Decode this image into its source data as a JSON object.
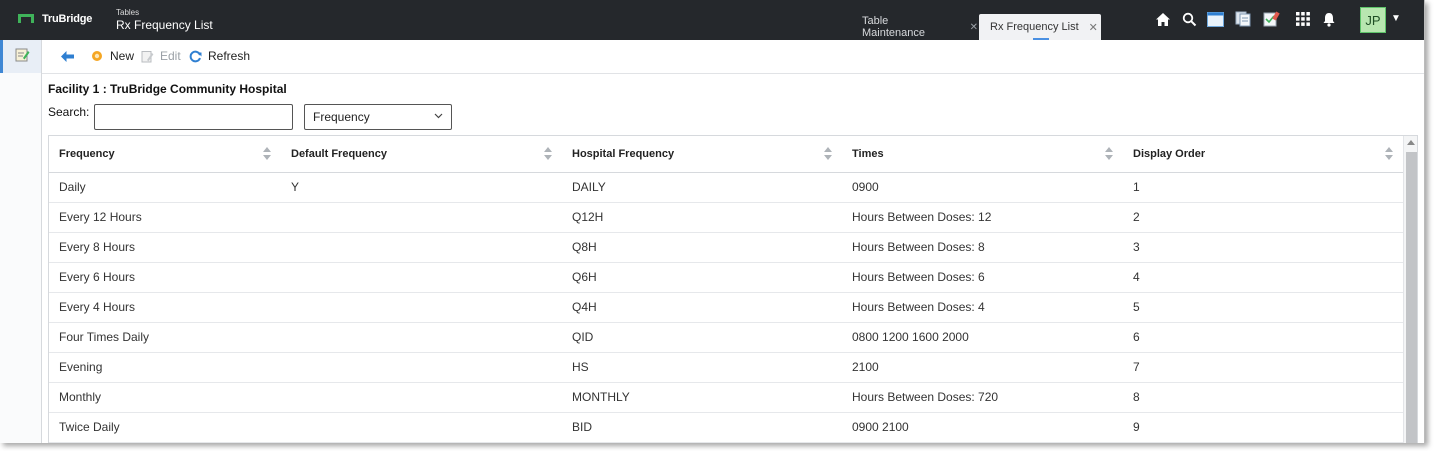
{
  "app": {
    "logo_text": "TruBridge",
    "breadcrumb_small": "Tables",
    "breadcrumb_title": "Rx Frequency List"
  },
  "tabs": [
    {
      "label": "Table Maintenance",
      "active": false
    },
    {
      "label": "Rx Frequency List",
      "active": true
    }
  ],
  "header_icons": [
    "home-icon",
    "search-icon",
    "window-icon",
    "documents-icon",
    "checklist-icon",
    "apps-grid-icon",
    "bell-icon"
  ],
  "user": {
    "initials": "JP"
  },
  "toolbar": {
    "new_label": "New",
    "edit_label": "Edit",
    "refresh_label": "Refresh"
  },
  "facility_title": "Facility 1 : TruBridge Community Hospital",
  "search": {
    "label": "Search:",
    "value": "",
    "placeholder": ""
  },
  "filter_select": {
    "value": "Frequency"
  },
  "table": {
    "columns": [
      "Frequency",
      "Default Frequency",
      "Hospital Frequency",
      "Times",
      "Display Order"
    ],
    "rows": [
      [
        "Daily",
        "Y",
        "DAILY",
        "0900",
        "1"
      ],
      [
        "Every 12 Hours",
        "",
        "Q12H",
        "Hours Between Doses: 12",
        "2"
      ],
      [
        "Every 8 Hours",
        "",
        "Q8H",
        "Hours Between Doses: 8",
        "3"
      ],
      [
        "Every 6 Hours",
        "",
        "Q6H",
        "Hours Between Doses: 6",
        "4"
      ],
      [
        "Every 4 Hours",
        "",
        "Q4H",
        "Hours Between Doses: 4",
        "5"
      ],
      [
        "Four Times Daily",
        "",
        "QID",
        "0800 1200 1600 2000",
        "6"
      ],
      [
        "Evening",
        "",
        "HS",
        "2100",
        "7"
      ],
      [
        "Monthly",
        "",
        "MONTHLY",
        "Hours Between Doses: 720",
        "8"
      ],
      [
        "Twice Daily",
        "",
        "BID",
        "0900 2100",
        "9"
      ]
    ]
  },
  "colors": {
    "topbar": "#25282c",
    "accent": "#3f87d4",
    "brand_green": "#3fb35a",
    "avatar_bg": "#b8e6b0"
  }
}
